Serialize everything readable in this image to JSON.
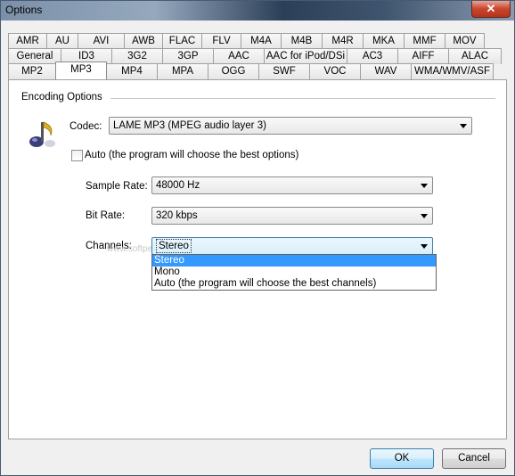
{
  "window": {
    "title": "Options",
    "close": "✕"
  },
  "tabs": {
    "row1": [
      "AMR",
      "AU",
      "AVI",
      "AWB",
      "FLAC",
      "FLV",
      "M4A",
      "M4B",
      "M4R",
      "MKA",
      "MMF",
      "MOV"
    ],
    "row2": [
      "General",
      "ID3",
      "3G2",
      "3GP",
      "AAC",
      "AAC for iPod/DSi",
      "AC3",
      "AIFF",
      "ALAC"
    ],
    "row3": [
      "MP2",
      "MP3",
      "MP4",
      "MPA",
      "OGG",
      "SWF",
      "VOC",
      "WAV",
      "WMA/WMV/ASF"
    ],
    "active": "MP3"
  },
  "panel": {
    "group_title": "Encoding Options",
    "codec_label": "Codec:",
    "codec_value": "LAME MP3 (MPEG audio layer 3)",
    "auto_label": "Auto (the program will choose the best options)",
    "sample_rate_label": "Sample Rate:",
    "sample_rate_value": "48000 Hz",
    "bit_rate_label": "Bit Rate:",
    "bit_rate_value": "320 kbps",
    "channels_label": "Channels:",
    "channels_value": "Stereo",
    "channels_options": [
      "Stereo",
      "Mono",
      "Auto (the program will choose the best channels)"
    ],
    "watermark": "www.softpedia.com"
  },
  "buttons": {
    "ok": "OK",
    "cancel": "Cancel"
  }
}
